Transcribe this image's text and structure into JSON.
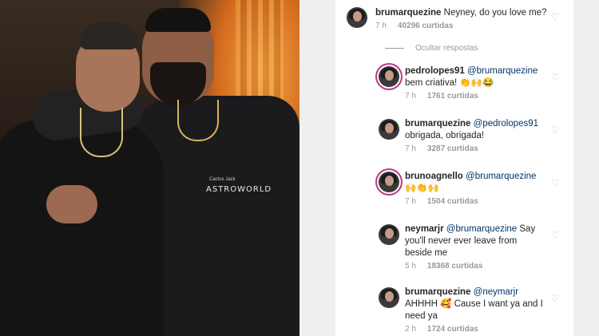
{
  "top_comment": {
    "username": "brumarquezine",
    "text": "Neyney, do you love me?",
    "time": "7 h",
    "likes": "40296 curtidas"
  },
  "hide_replies_label": "Ocultar respostas",
  "replies": [
    {
      "username": "pedrolopes91",
      "mention": "@brumarquezine",
      "text_line1": "",
      "text_line2": "bem criativa! 👏🙌😂",
      "time": "7 h",
      "likes": "1761 curtidas",
      "avatar": "person"
    },
    {
      "username": "brumarquezine",
      "mention": "@pedrolopes91",
      "text_line1": "",
      "text_line2": "obrigada, obrigada!",
      "time": "7 h",
      "likes": "3287 curtidas",
      "avatar": "person"
    },
    {
      "username": "brunoagnello",
      "mention": "@brumarquezine",
      "text_line1": "",
      "text_line2": "🙌👏🙌",
      "time": "7 h",
      "likes": "1504 curtidas",
      "avatar": "person"
    },
    {
      "username": "neymarjr",
      "mention": "@brumarquezine",
      "text_line1": "Say",
      "text_line2": "you'll never ever leave from",
      "text_line3": "beside me",
      "time": "5 h",
      "likes": "18368 curtidas",
      "avatar": "person"
    },
    {
      "username": "brumarquezine",
      "mention": "@neymarjr",
      "text_line1": "",
      "text_line2": "AHHHH 🥰 Cause I want ya and I",
      "text_line3": "need ya",
      "time": "2 h",
      "likes": "1724 curtidas",
      "avatar": "person"
    }
  ],
  "photo": {
    "shirt_text": "ASTROWORLD",
    "shirt_small": "Cactus Jack"
  }
}
